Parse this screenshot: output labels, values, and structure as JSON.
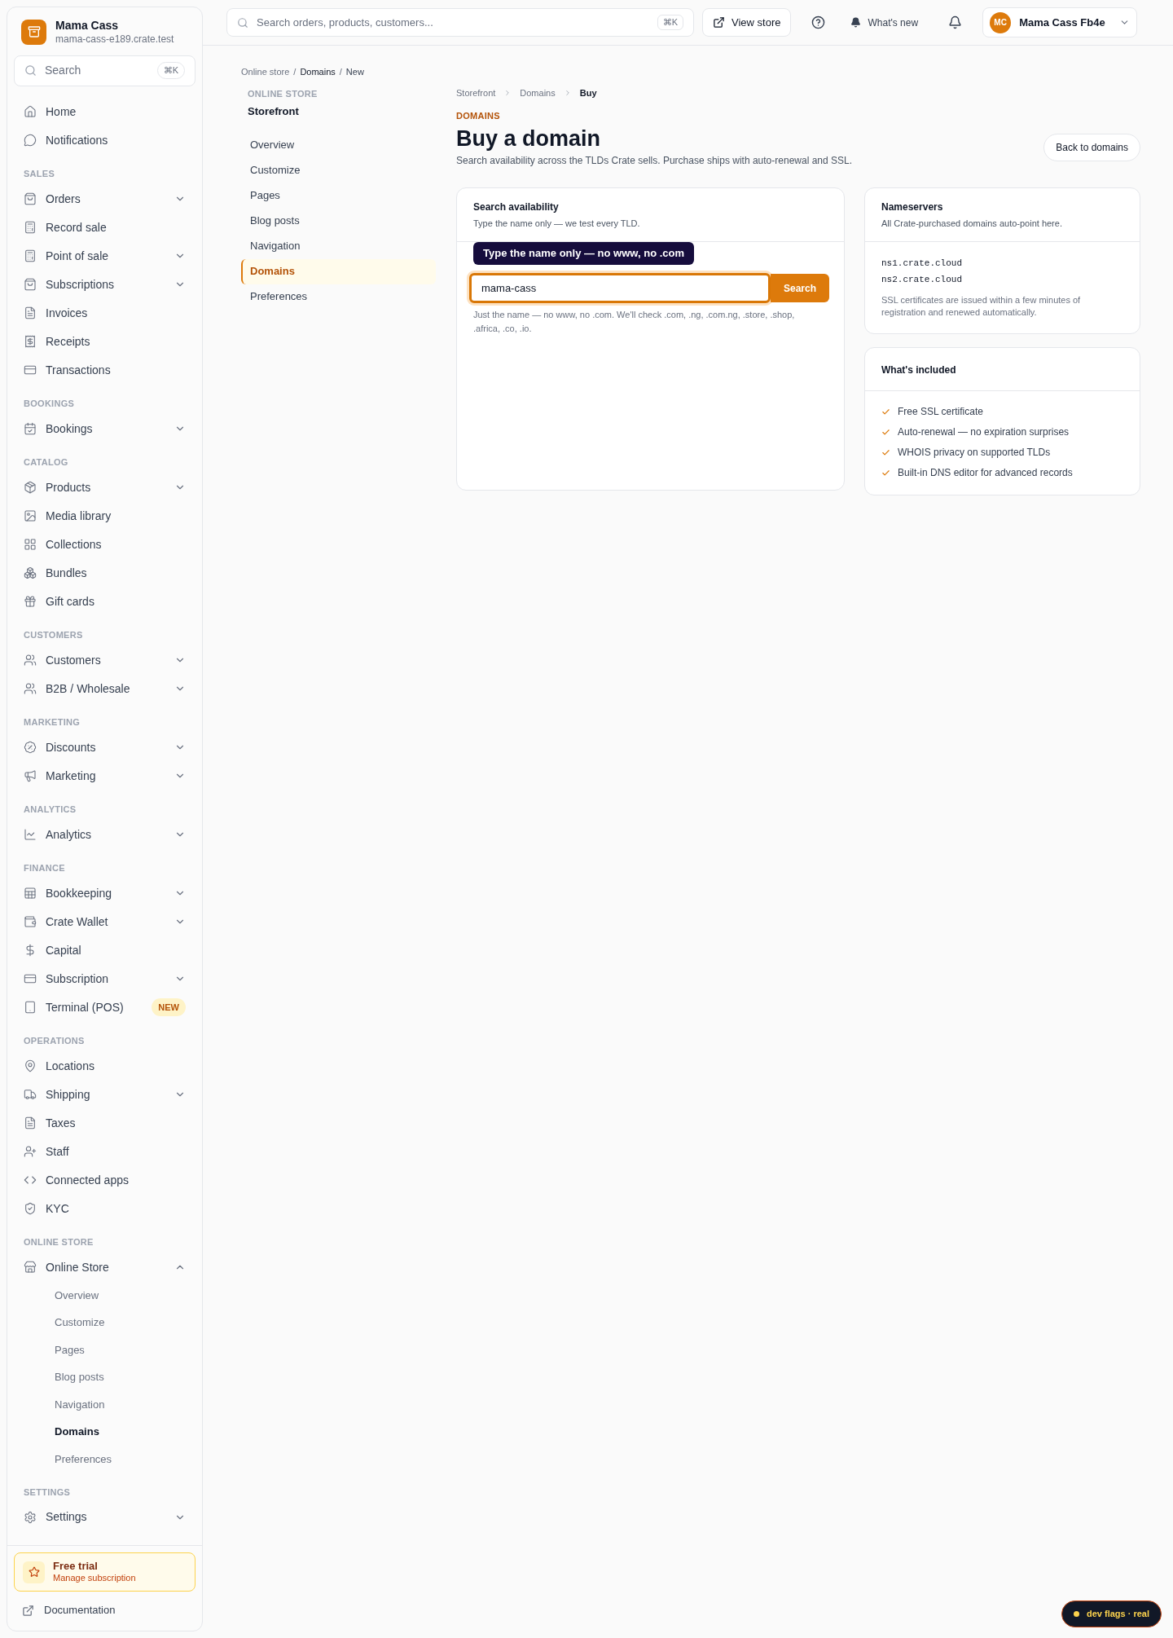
{
  "sidebar": {
    "store": {
      "name": "Mama Cass",
      "domain": "mama-cass-e189.crate.test"
    },
    "search": {
      "placeholder": "Search",
      "shortcut": "⌘K"
    },
    "sections": [
      {
        "items": [
          {
            "label": "Home",
            "kind": "link"
          },
          {
            "label": "Notifications",
            "kind": "link"
          }
        ]
      },
      {
        "title": "SALES",
        "items": [
          {
            "label": "Orders",
            "kind": "group",
            "expanded": false
          },
          {
            "label": "Record sale",
            "kind": "link"
          },
          {
            "label": "Point of sale",
            "kind": "group",
            "expanded": false
          },
          {
            "label": "Subscriptions",
            "kind": "group",
            "expanded": false
          },
          {
            "label": "Invoices",
            "kind": "link"
          },
          {
            "label": "Receipts",
            "kind": "link"
          },
          {
            "label": "Transactions",
            "kind": "link"
          }
        ]
      },
      {
        "title": "BOOKINGS",
        "items": [
          {
            "label": "Bookings",
            "kind": "group",
            "expanded": false
          }
        ]
      },
      {
        "title": "CATALOG",
        "items": [
          {
            "label": "Products",
            "kind": "group",
            "expanded": false
          },
          {
            "label": "Media library",
            "kind": "link"
          },
          {
            "label": "Collections",
            "kind": "link"
          },
          {
            "label": "Bundles",
            "kind": "link"
          },
          {
            "label": "Gift cards",
            "kind": "link"
          }
        ]
      },
      {
        "title": "CUSTOMERS",
        "items": [
          {
            "label": "Customers",
            "kind": "group",
            "expanded": false
          },
          {
            "label": "B2B / Wholesale",
            "kind": "group",
            "expanded": false
          }
        ]
      },
      {
        "title": "MARKETING",
        "items": [
          {
            "label": "Discounts",
            "kind": "group",
            "expanded": false
          },
          {
            "label": "Marketing",
            "kind": "group",
            "expanded": false
          }
        ]
      },
      {
        "title": "ANALYTICS",
        "items": [
          {
            "label": "Analytics",
            "kind": "group",
            "expanded": false
          }
        ]
      },
      {
        "title": "FINANCE",
        "items": [
          {
            "label": "Bookkeeping",
            "kind": "group",
            "expanded": false
          },
          {
            "label": "Crate Wallet",
            "kind": "group",
            "expanded": false
          },
          {
            "label": "Capital",
            "kind": "link"
          },
          {
            "label": "Subscription",
            "kind": "group",
            "expanded": false
          },
          {
            "label": "Terminal (POS)",
            "kind": "link",
            "badge": "NEW"
          }
        ]
      },
      {
        "title": "OPERATIONS",
        "items": [
          {
            "label": "Locations",
            "kind": "link"
          },
          {
            "label": "Shipping",
            "kind": "group",
            "expanded": false
          },
          {
            "label": "Taxes",
            "kind": "link"
          },
          {
            "label": "Staff",
            "kind": "link"
          },
          {
            "label": "Connected apps",
            "kind": "link"
          },
          {
            "label": "KYC",
            "kind": "link"
          }
        ]
      },
      {
        "title": "ONLINE STORE",
        "items": [
          {
            "label": "Online Store",
            "kind": "group",
            "expanded": true,
            "children": [
              {
                "label": "Overview",
                "selected": false
              },
              {
                "label": "Customize",
                "selected": false
              },
              {
                "label": "Pages",
                "selected": false
              },
              {
                "label": "Blog posts",
                "selected": false
              },
              {
                "label": "Navigation",
                "selected": false
              },
              {
                "label": "Domains",
                "selected": true
              },
              {
                "label": "Preferences",
                "selected": false
              }
            ]
          }
        ]
      },
      {
        "title": "SETTINGS",
        "items": [
          {
            "label": "Settings",
            "kind": "group",
            "expanded": false
          }
        ]
      }
    ],
    "trial": {
      "title": "Free trial",
      "link": "Manage subscription"
    },
    "footer_link": "Documentation"
  },
  "topbar": {
    "search": {
      "placeholder": "Search orders, products, customers...",
      "shortcut": "⌘K"
    },
    "view_store": "View store",
    "whats_new": "What's new",
    "user": {
      "initials": "MC",
      "name": "Mama Cass Fb4e"
    }
  },
  "page_breadcrumb": [
    "Online store",
    "Domains",
    "New"
  ],
  "page_breadcrumb_separator": "/",
  "subnav": {
    "eyebrow": "ONLINE STORE",
    "title": "Storefront",
    "items": [
      {
        "label": "Overview",
        "selected": false
      },
      {
        "label": "Customize",
        "selected": false
      },
      {
        "label": "Pages",
        "selected": false
      },
      {
        "label": "Blog posts",
        "selected": false
      },
      {
        "label": "Navigation",
        "selected": false
      },
      {
        "label": "Domains",
        "selected": true
      },
      {
        "label": "Preferences",
        "selected": false
      }
    ]
  },
  "content": {
    "breadcrumb": [
      "Storefront",
      "Domains",
      "Buy"
    ],
    "eyebrow": "DOMAINS",
    "title": "Buy a domain",
    "description": "Search availability across the TLDs Crate sells. Purchase ships with auto-renewal and SSL.",
    "back_button": "Back to domains",
    "search_card": {
      "title": "Search availability",
      "subtitle": "Type the name only — we test every TLD.",
      "tooltip": "Type the name only — no www, no .com",
      "value": "mama-cass",
      "button": "Search",
      "help": "Just the name — no www, no .com. We'll check .com, .ng, .com.ng, .store, .shop, .africa, .co, .io."
    },
    "nameservers": {
      "title": "Nameservers",
      "subtitle": "All Crate-purchased domains auto-point here.",
      "servers": [
        "ns1.crate.cloud",
        "ns2.crate.cloud"
      ],
      "note": "SSL certificates are issued within a few minutes of registration and renewed automatically."
    },
    "included": {
      "title": "What's included",
      "items": [
        "Free SSL certificate",
        "Auto-renewal — no expiration surprises",
        "WHOIS privacy on supported TLDs",
        "Built-in DNS editor for advanced records"
      ]
    }
  },
  "dev_flags": "dev flags · real"
}
